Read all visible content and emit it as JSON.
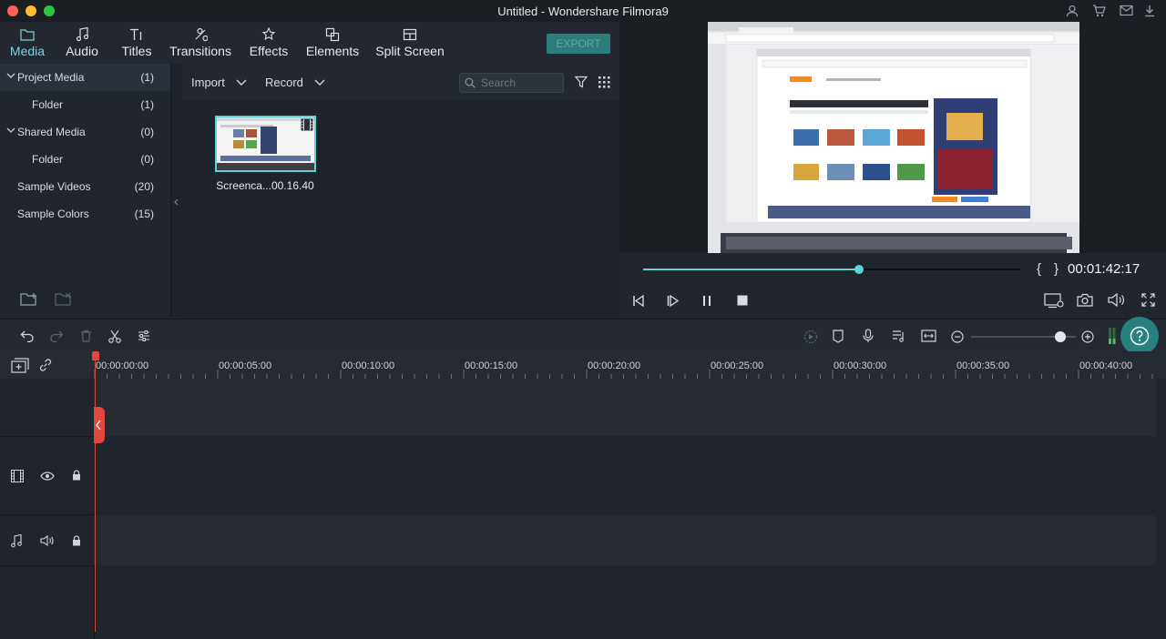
{
  "window": {
    "title": "Untitled - Wondershare Filmora9"
  },
  "colors": {
    "accent": "#5fd3d8",
    "playhead": "#e2473f",
    "export_bg": "#2c7d7c"
  },
  "toolbar": {
    "tabs": [
      {
        "label": "Media",
        "icon": "folder-icon",
        "active": true
      },
      {
        "label": "Audio",
        "icon": "music-note-icon"
      },
      {
        "label": "Titles",
        "icon": "text-icon"
      },
      {
        "label": "Transitions",
        "icon": "transitions-icon"
      },
      {
        "label": "Effects",
        "icon": "effects-icon"
      },
      {
        "label": "Elements",
        "icon": "elements-icon"
      },
      {
        "label": "Split Screen",
        "icon": "split-screen-icon"
      }
    ],
    "export_label": "EXPORT"
  },
  "library": {
    "items": [
      {
        "label": "Project Media",
        "count": "(1)"
      },
      {
        "label": "Folder",
        "count": "(1)"
      },
      {
        "label": "Shared Media",
        "count": "(0)"
      },
      {
        "label": "Folder",
        "count": "(0)"
      },
      {
        "label": "Sample Videos",
        "count": "(20)"
      },
      {
        "label": "Sample Colors",
        "count": "(15)"
      }
    ]
  },
  "media": {
    "import_label": "Import",
    "record_label": "Record",
    "search_placeholder": "Search",
    "clip_name": "Screenca...00.16.40"
  },
  "preview": {
    "timecode": "00:01:42:17",
    "bracket_in": "{",
    "bracket_out": "}",
    "progress": 0.57
  },
  "timeline": {
    "ruler_labels": [
      "00:00:00:00",
      "00:00:05:00",
      "00:00:10:00",
      "00:00:15:00",
      "00:00:20:00",
      "00:00:25:00",
      "00:00:30:00",
      "00:00:35:00",
      "00:00:40:00"
    ],
    "zoom_level": 0.85
  }
}
